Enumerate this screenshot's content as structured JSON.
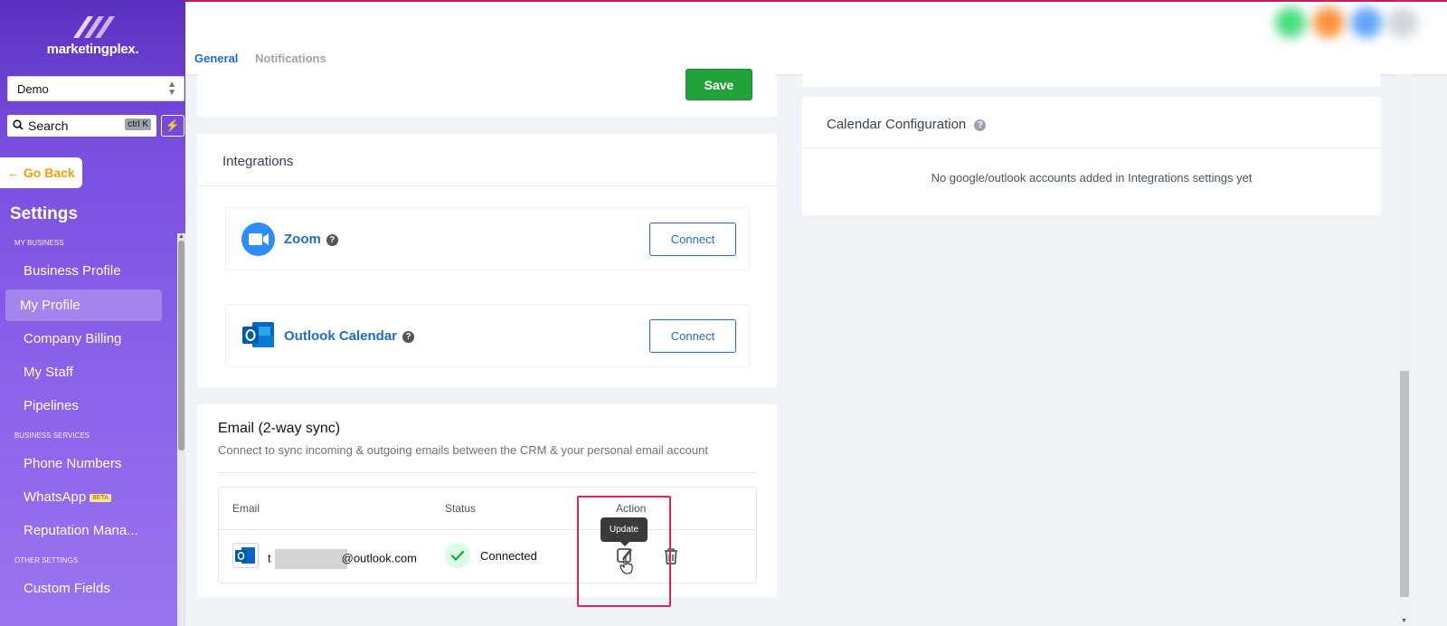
{
  "app": {
    "logo_text": "marketingplex."
  },
  "sidebar": {
    "account": "Demo",
    "search_placeholder": "Search",
    "search_shortcut": "ctrl K",
    "go_back": "Go Back",
    "title": "Settings",
    "sections": [
      {
        "label": "MY BUSINESS",
        "items": [
          "Business Profile",
          "My Profile",
          "Company Billing",
          "My Staff",
          "Pipelines"
        ]
      },
      {
        "label": "BUSINESS SERVICES",
        "items": [
          "Phone Numbers",
          "WhatsApp",
          "Reputation Mana..."
        ]
      },
      {
        "label": "OTHER SETTINGS",
        "items": [
          "Custom Fields"
        ]
      }
    ],
    "active_item": "My Profile",
    "beta_badge": "BETA"
  },
  "tabs": {
    "general": "General",
    "notifications": "Notifications"
  },
  "save_label": "Save",
  "integrations": {
    "title": "Integrations",
    "items": [
      {
        "name": "Zoom",
        "button": "Connect",
        "icon": "zoom-icon"
      },
      {
        "name": "Outlook Calendar",
        "button": "Connect",
        "icon": "outlook-icon"
      }
    ]
  },
  "calendar": {
    "title": "Calendar Configuration",
    "empty_text": "No google/outlook accounts added in Integrations settings yet"
  },
  "email_sync": {
    "title": "Email (2-way sync)",
    "subtitle": "Connect to sync incoming & outgoing emails between the CRM & your personal email account",
    "columns": [
      "Email",
      "Status",
      "Action"
    ],
    "rows": [
      {
        "email_prefix": "t",
        "email_domain": "@outlook.com",
        "status": "Connected"
      }
    ],
    "tooltip": "Update"
  },
  "colors": {
    "accent": "#1e6bd8",
    "save": "#22a33a",
    "sidebar": "#7b4fe0",
    "highlight": "#e0245e"
  }
}
